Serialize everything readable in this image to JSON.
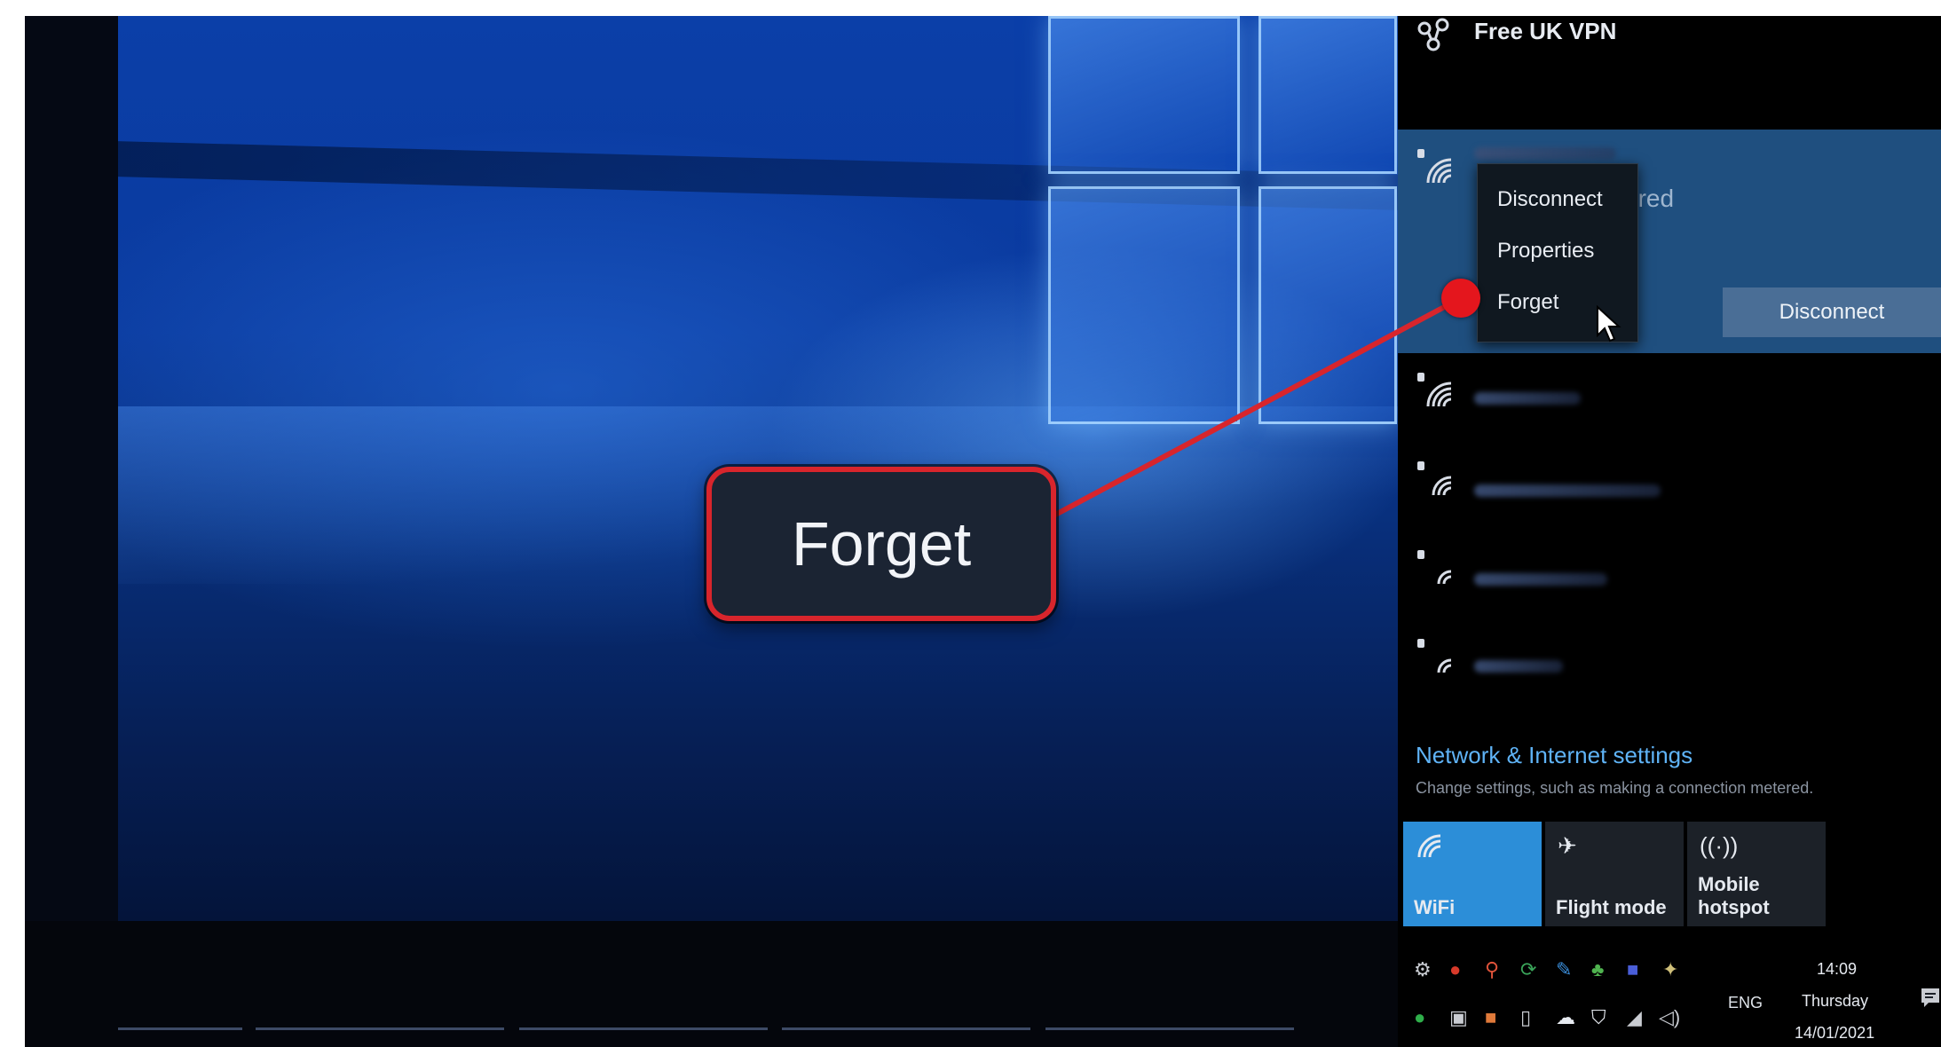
{
  "callout": {
    "label": "Forget"
  },
  "flyout": {
    "vpn": {
      "name": "Free UK VPN"
    },
    "active_network": {
      "status": "ured",
      "disconnect_button": "Disconnect"
    },
    "context_menu": {
      "items": [
        "Disconnect",
        "Properties",
        "Forget"
      ]
    },
    "settings": {
      "link": "Network & Internet settings",
      "description": "Change settings, such as making a connection metered."
    },
    "quick_actions": [
      {
        "label": "WiFi",
        "icon": "wifi-icon",
        "active": true
      },
      {
        "label": "Flight mode",
        "icon": "airplane-icon",
        "active": false
      },
      {
        "label": "Mobile hotspot",
        "icon": "hotspot-icon",
        "active": false
      }
    ]
  },
  "taskbar": {
    "language": "ENG",
    "time": "14:09",
    "day": "Thursday",
    "date": "14/01/2021"
  },
  "colors": {
    "accent": "#2c8ed8",
    "callout_border": "#d8252c",
    "link": "#5fb3f6",
    "active_network_bg": "#1f4f7f"
  }
}
